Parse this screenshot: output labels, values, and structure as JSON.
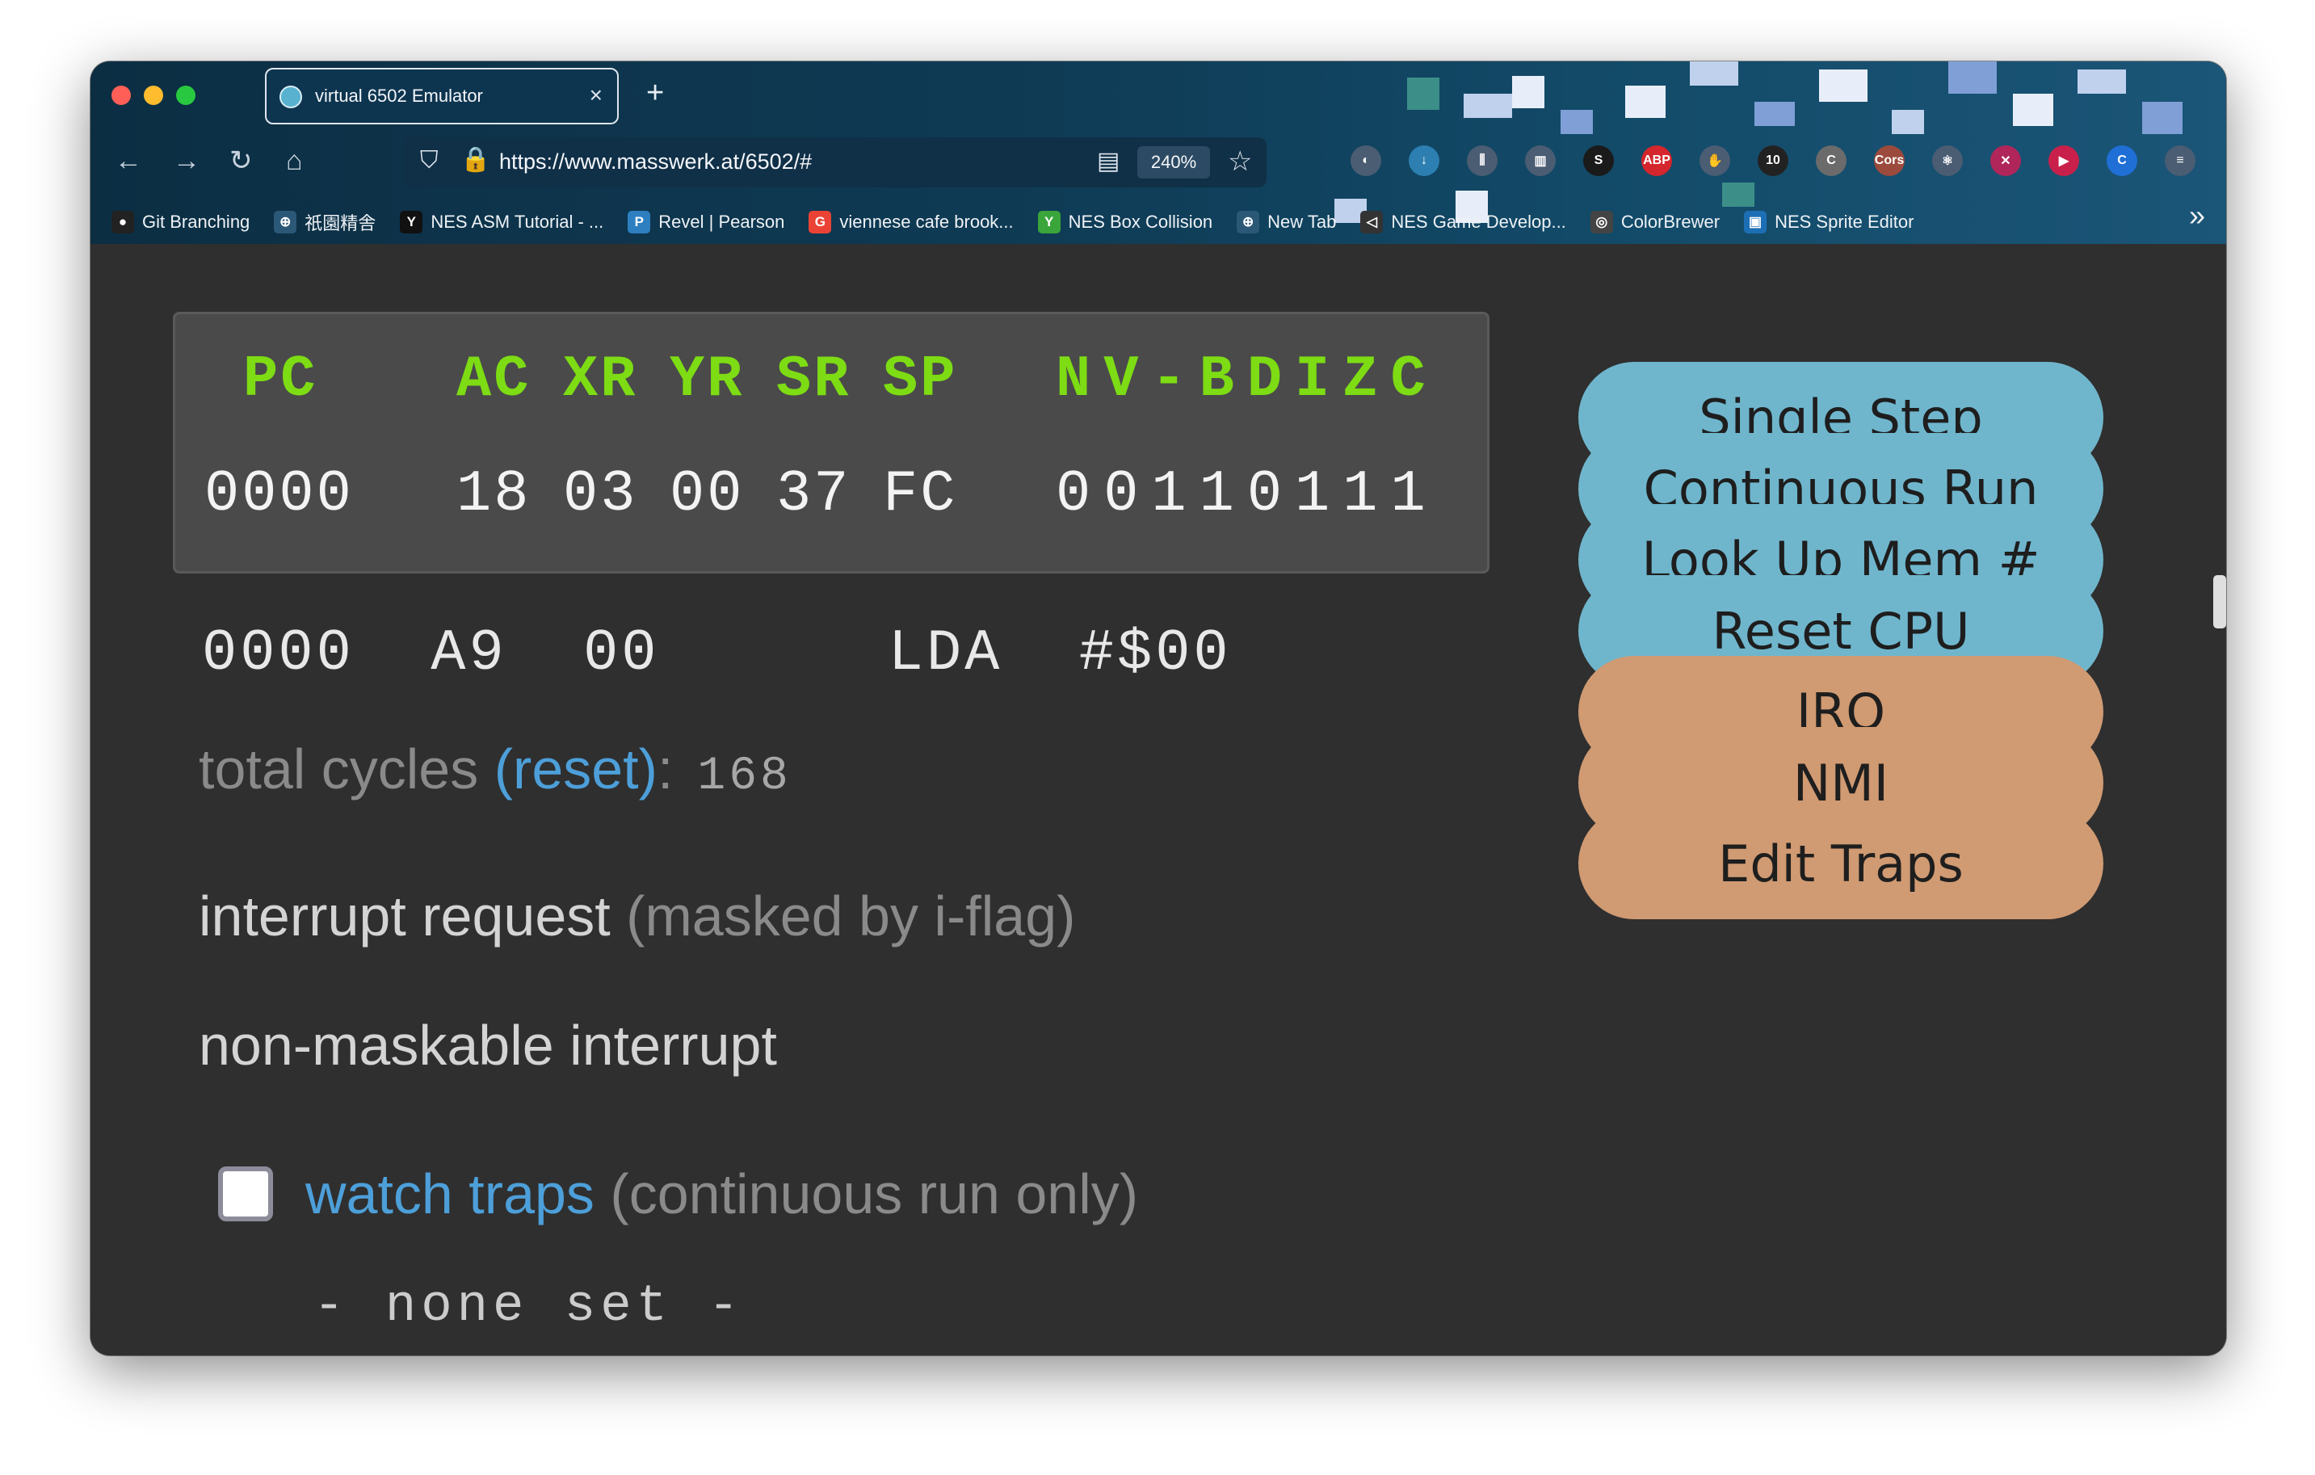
{
  "browser": {
    "tab_title": "virtual 6502 Emulator",
    "tab_close": "×",
    "new_tab": "+",
    "nav": {
      "back": "←",
      "forward": "→",
      "reload": "↻",
      "home": "⌂"
    },
    "url": "https://www.masswerk.at/6502/#",
    "zoom": "240%",
    "icons": {
      "shield": "⛉",
      "lock": "🔒",
      "reader": "▤",
      "star": "☆"
    },
    "extensions": [
      {
        "name": "pocket-icon",
        "label": "◐",
        "color": "#4b5d73"
      },
      {
        "name": "download-icon",
        "label": "↓",
        "color": "#2c7fb0"
      },
      {
        "name": "library-icon",
        "label": "⫼",
        "color": "#4b5d73"
      },
      {
        "name": "sidebar-icon",
        "label": "▥",
        "color": "#4b5d73"
      },
      {
        "name": "s-extension-icon",
        "label": "S",
        "color": "#1a1a1a"
      },
      {
        "name": "adblock-icon",
        "label": "ABP",
        "color": "#d4262c"
      },
      {
        "name": "hand-extension-icon",
        "label": "✋",
        "color": "#4b5d73"
      },
      {
        "name": "ten-extension-icon",
        "label": "10",
        "color": "#222222"
      },
      {
        "name": "c-extension-icon",
        "label": "C",
        "color": "#6b6b6b"
      },
      {
        "name": "cors-extension-icon",
        "label": "Cors",
        "color": "#9b4a3c"
      },
      {
        "name": "react-devtools-icon",
        "label": "⚛",
        "color": "#4b5d73"
      },
      {
        "name": "x-extension-icon",
        "label": "✕",
        "color": "#b0265a"
      },
      {
        "name": "record-extension-icon",
        "label": "▶",
        "color": "#c8204a"
      },
      {
        "name": "copy-extension-icon",
        "label": "C",
        "color": "#1f6fd6"
      },
      {
        "name": "menu-icon",
        "label": "≡",
        "color": "#4b5d73"
      }
    ],
    "bookmarks": [
      {
        "label": "Git Branching",
        "icon": "●",
        "color": "#222222"
      },
      {
        "label": "祇園精舎",
        "icon": "⊕",
        "color": "#2b5877"
      },
      {
        "label": "NES ASM Tutorial - ...",
        "icon": "Y",
        "color": "#111111"
      },
      {
        "label": "Revel | Pearson",
        "icon": "P",
        "color": "#2d7fc0"
      },
      {
        "label": "viennese cafe brook...",
        "icon": "G",
        "color": "#ea4335"
      },
      {
        "label": "NES Box Collision",
        "icon": "Y",
        "color": "#3aa53a"
      },
      {
        "label": "New Tab",
        "icon": "⊕",
        "color": "#2b5877"
      },
      {
        "label": "NES Game Develop...",
        "icon": "◁",
        "color": "#333333"
      },
      {
        "label": "ColorBrewer",
        "icon": "◎",
        "color": "#444444"
      },
      {
        "label": "NES Sprite Editor",
        "icon": "▣",
        "color": "#1d6fb5"
      }
    ],
    "bookmarks_more": "»"
  },
  "registers": {
    "headers": {
      "pc": "PC",
      "ac": "AC",
      "xr": "XR",
      "yr": "YR",
      "sr": "SR",
      "sp": "SP",
      "flags": "NV-BDIZC"
    },
    "values": {
      "pc": "0000",
      "ac": "18",
      "xr": "03",
      "yr": "00",
      "sr": "37",
      "sp": "FC",
      "flags": "00110111"
    }
  },
  "disassembly": {
    "address": "0000",
    "opcode": "A9",
    "operand": "00",
    "mnemonic": "LDA",
    "argument": "#$00"
  },
  "cycles": {
    "label": "total cycles ",
    "reset": "(reset)",
    "colon": ":",
    "count": "168"
  },
  "interrupt": {
    "label": "interrupt request ",
    "note": "(masked by i-flag)"
  },
  "nmi": {
    "label": "non-maskable interrupt"
  },
  "traps": {
    "link": "watch traps",
    "note": " (continuous run only)",
    "checked": false,
    "none_set": "- none set -"
  },
  "buttons": {
    "single_step": "Single Step",
    "continuous_run": "Continuous Run",
    "look_up_mem": "Look Up Mem #",
    "reset_cpu": "Reset CPU",
    "irq": "IRQ",
    "nmi": "NMI",
    "edit_traps": "Edit Traps"
  },
  "colors": {
    "register_header": "#7ddc13",
    "link": "#4d9fd9",
    "button_blue": "#6fb6cd",
    "button_tan": "#d09a72",
    "background": "#2f2f2f"
  }
}
